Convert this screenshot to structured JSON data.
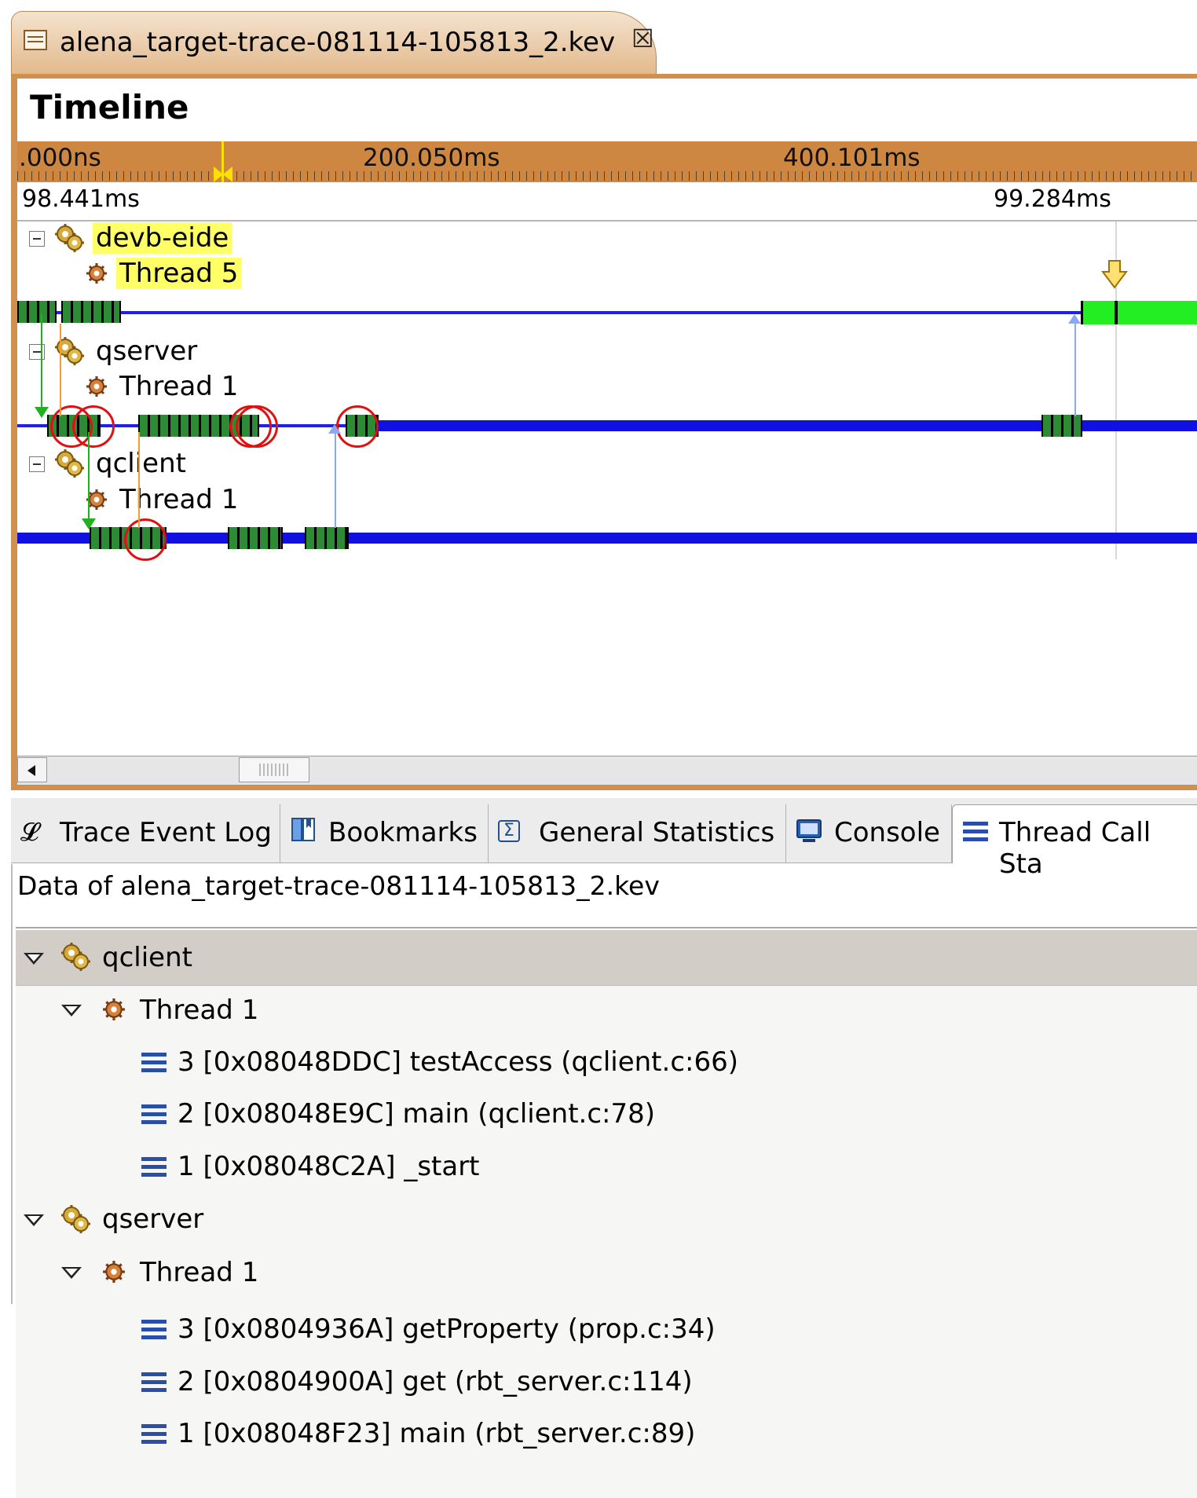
{
  "editor": {
    "tab_title": "alena_target-trace-081114-105813_2.kev",
    "tab_icon": "trace-file-icon",
    "close_icon": "close-icon"
  },
  "timeline": {
    "title": "Timeline",
    "ruler_labels": [
      ".000ns",
      "200.050ms",
      "400.101ms"
    ],
    "range_start": "98.441ms",
    "range_end": "99.284ms",
    "processes": [
      {
        "name": "devb-eide",
        "highlighted": true,
        "threads": [
          {
            "name": "Thread 5",
            "highlighted": true
          }
        ]
      },
      {
        "name": "qserver",
        "highlighted": false,
        "threads": [
          {
            "name": "Thread 1",
            "highlighted": false
          }
        ]
      },
      {
        "name": "qclient",
        "highlighted": false,
        "threads": [
          {
            "name": "Thread 1",
            "highlighted": false
          }
        ]
      }
    ],
    "colors": {
      "track": "#1010e0",
      "running": "#2e8b35",
      "running_bright": "#22ee22",
      "highlight": "#ffff66",
      "ruler": "#cd8740"
    }
  },
  "view_tabs": [
    {
      "label": "Trace Event Log",
      "icon": "log-icon",
      "active": false
    },
    {
      "label": "Bookmarks",
      "icon": "bookmarks-icon",
      "active": false
    },
    {
      "label": "General Statistics",
      "icon": "statistics-icon",
      "active": false
    },
    {
      "label": "Console",
      "icon": "console-icon",
      "active": false
    },
    {
      "label": "Thread Call Sta",
      "icon": "call-stack-icon",
      "active": true
    }
  ],
  "call_stack": {
    "data_label": "Data of alena_target-trace-081114-105813_2.kev",
    "processes": [
      {
        "name": "qclient",
        "thread": "Thread 1",
        "frames": [
          "3 [0x08048DDC] testAccess (qclient.c:66)",
          "2 [0x08048E9C] main (qclient.c:78)",
          "1 [0x08048C2A] _start"
        ]
      },
      {
        "name": "qserver",
        "thread": "Thread 1",
        "frames": [
          "3 [0x0804936A] getProperty (prop.c:34)",
          "2 [0x0804900A] get (rbt_server.c:114)",
          "1 [0x08048F23] main (rbt_server.c:89)"
        ]
      }
    ]
  }
}
